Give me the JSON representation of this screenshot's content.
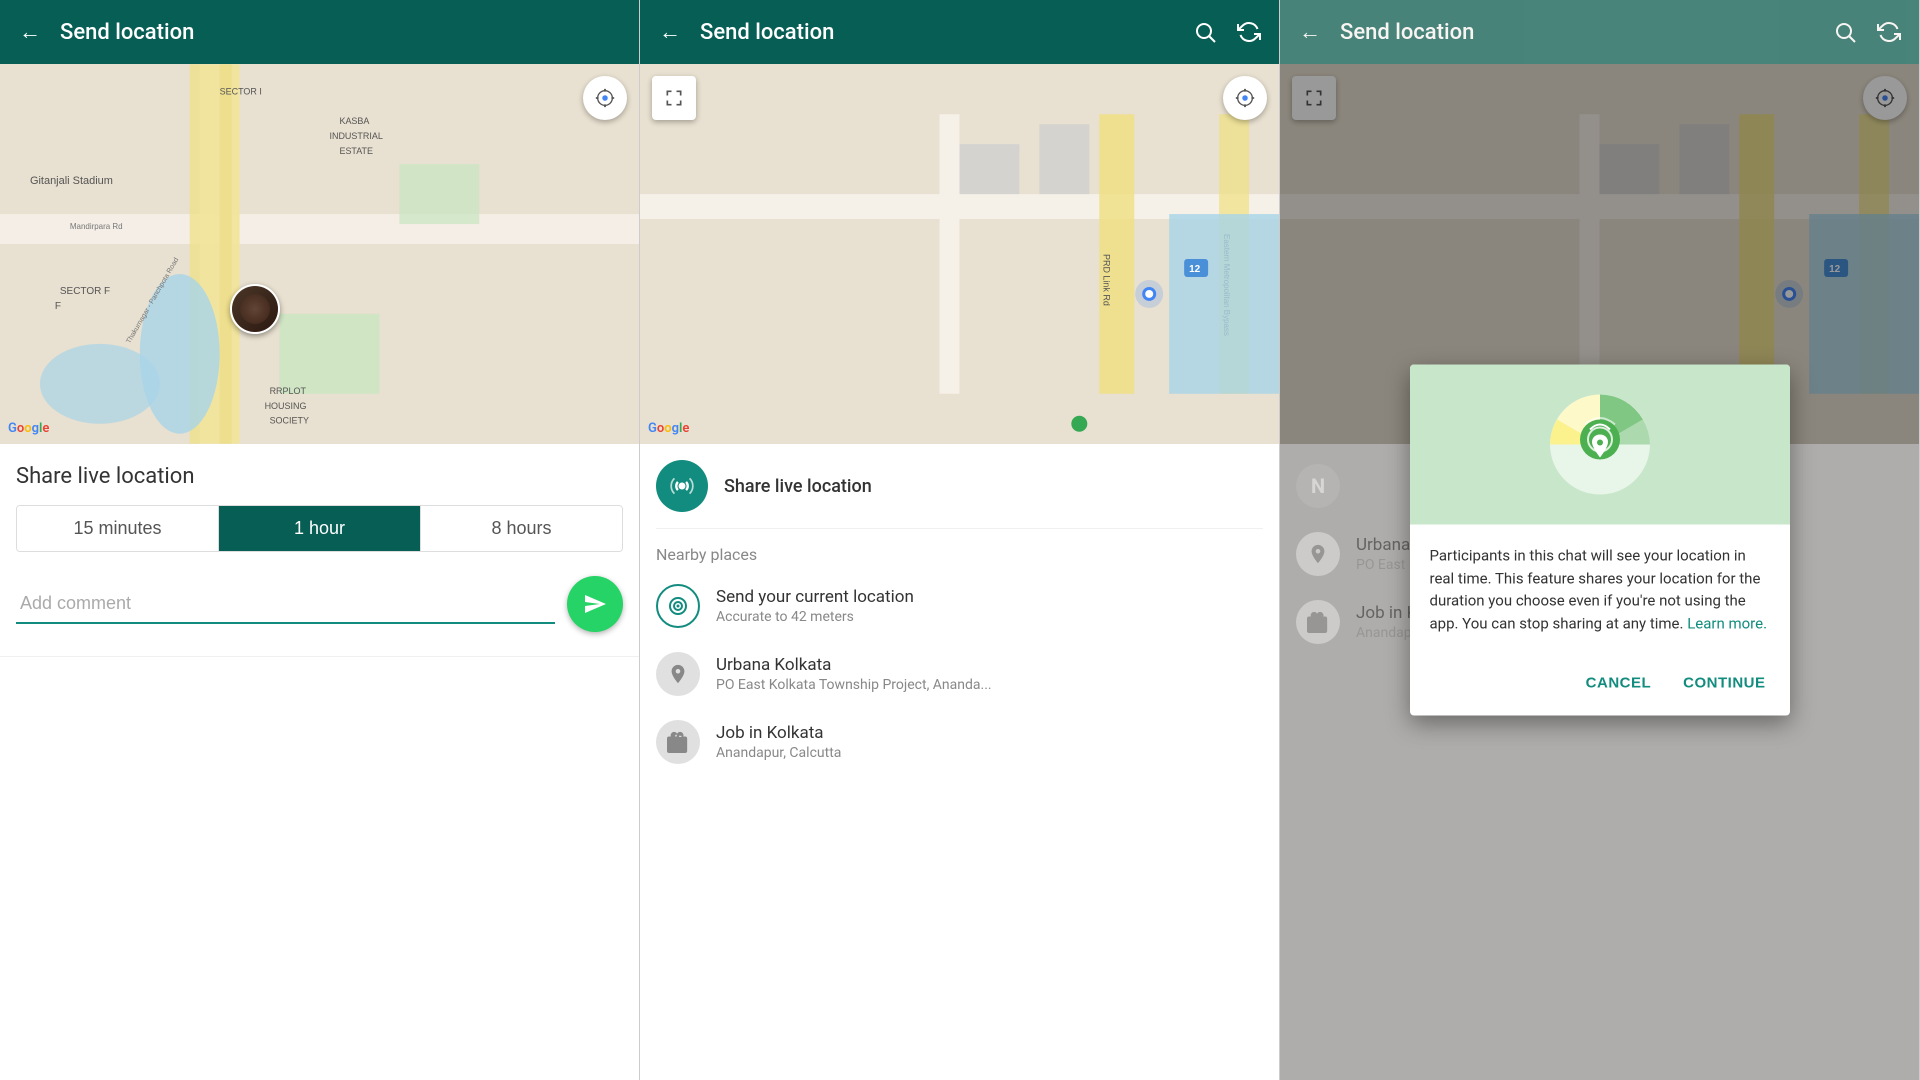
{
  "panels": [
    {
      "id": "panel1",
      "header": {
        "title": "Send location",
        "back_label": "←",
        "show_search": false,
        "show_refresh": false
      },
      "share_section": {
        "title": "Share live location",
        "durations": [
          {
            "label": "15 minutes",
            "active": false
          },
          {
            "label": "1 hour",
            "active": true
          },
          {
            "label": "8 hours",
            "active": false
          }
        ],
        "comment_placeholder": "Add comment",
        "send_icon": "➤"
      }
    },
    {
      "id": "panel2",
      "header": {
        "title": "Send location",
        "back_label": "←",
        "show_search": true,
        "show_refresh": true
      },
      "live_location": {
        "label": "Share live location"
      },
      "nearby_label": "Nearby places",
      "locations": [
        {
          "name": "Send your current location",
          "sub": "Accurate to 42 meters",
          "type": "current"
        },
        {
          "name": "Urbana Kolkata",
          "sub": "PO East Kolkata Township Project, Ananda...",
          "type": "place"
        },
        {
          "name": "Job in Kolkata",
          "sub": "Anandapur, Calcutta",
          "type": "job"
        }
      ]
    },
    {
      "id": "panel3",
      "header": {
        "title": "Send location",
        "back_label": "←",
        "show_search": true,
        "show_refresh": true
      },
      "dialog": {
        "text_part1": "Participants in this chat will see your location in real time. This feature shares your location for the duration you choose even if you're not using the app. You can stop sharing at any time. ",
        "link_text": "Learn more.",
        "cancel_label": "CANCEL",
        "continue_label": "CONTINUE"
      },
      "locations": [
        {
          "name": "Urbana Kolkata",
          "sub": "PO East Kolkata Township Project, Ananda...",
          "type": "place"
        },
        {
          "name": "Job in Kolkata",
          "sub": "Anandapur, Calcutta",
          "type": "job"
        }
      ]
    }
  ]
}
